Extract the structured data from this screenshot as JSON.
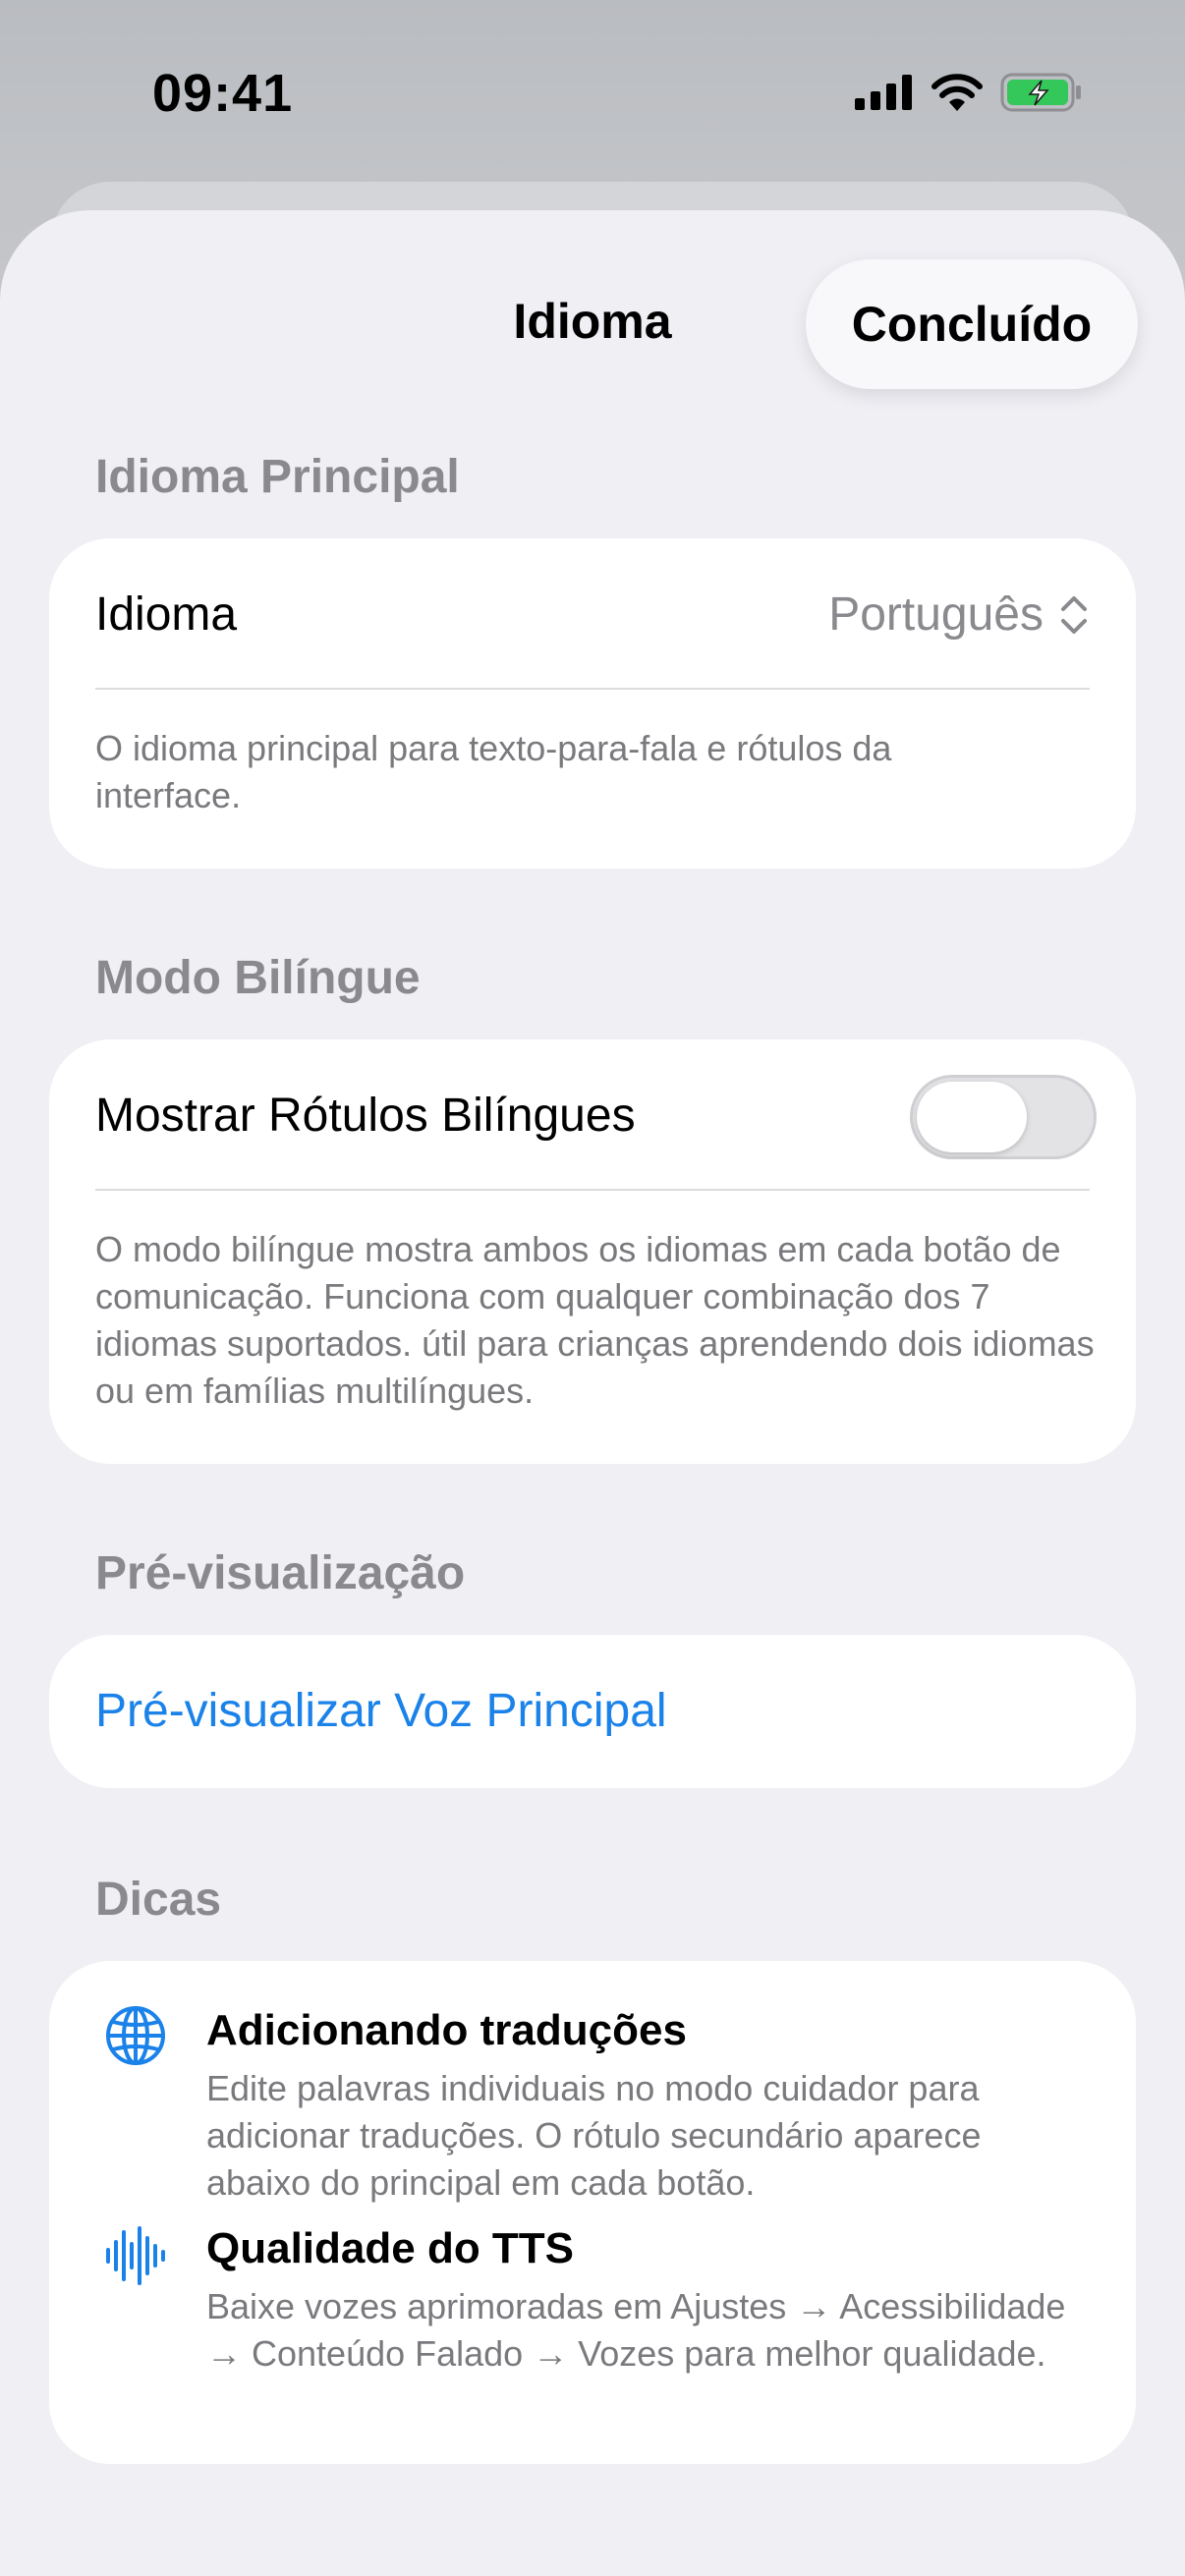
{
  "status_bar": {
    "time": "09:41"
  },
  "header": {
    "title": "Idioma",
    "done_label": "Concluído"
  },
  "primary_language": {
    "section_title": "Idioma Principal",
    "row_label": "Idioma",
    "selected_value": "Português",
    "footnote": "O idioma principal para texto-para-fala e rótulos da interface."
  },
  "bilingual": {
    "section_title": "Modo Bilíngue",
    "toggle_label": "Mostrar Rótulos Bilíngues",
    "toggle_on": false,
    "footnote": "O modo bilíngue mostra ambos os idiomas em cada botão de comunicação. Funciona com qualquer combinação dos 7 idiomas suportados. útil para crianças aprendendo dois idiomas ou em famílias multilíngues."
  },
  "preview": {
    "section_title": "Pré-visualização",
    "button_label": "Pré-visualizar Voz Principal"
  },
  "tips": {
    "section_title": "Dicas",
    "items": [
      {
        "icon": "globe-icon",
        "title": "Adicionando traduções",
        "body": "Edite palavras individuais no modo cuidador para adicionar traduções. O rótulo secundário aparece abaixo do principal em cada botão."
      },
      {
        "icon": "waveform-icon",
        "title": "Qualidade do TTS",
        "body": "Baixe vozes aprimoradas em Ajustes → Acessibilidade → Conteúdo Falado → Vozes para melhor qualidade."
      }
    ]
  },
  "colors": {
    "accent": "#1a82e8",
    "battery": "#34c759",
    "sheet_background": "#efeff4",
    "secondary_text": "#8a8a8e"
  }
}
